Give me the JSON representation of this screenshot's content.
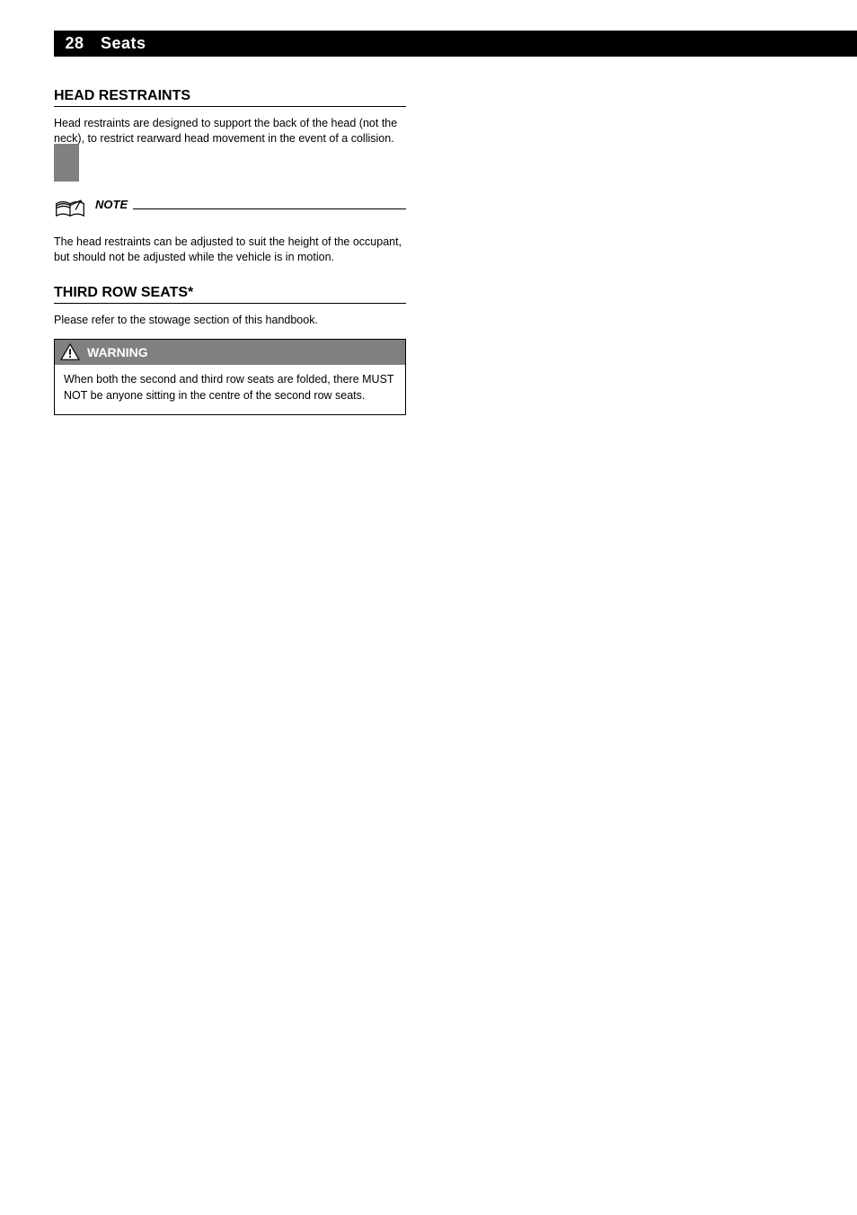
{
  "page_number": "28",
  "header_title": "Seats",
  "section1": {
    "title": "HEAD RESTRAINTS",
    "para": "Head restraints are designed to support the back of the head (not the neck), to restrict rearward head movement in the event of a collision."
  },
  "note": {
    "label": "NOTE",
    "body": "The head restraints can be adjusted to suit the height of the occupant, but should not be adjusted while the vehicle is in motion."
  },
  "section2": {
    "title": "THIRD ROW SEATS*",
    "para": "Please refer to the stowage section of this handbook.",
    "warning_label": "WARNING",
    "warning_body": "When both the second and third row seats are folded, there MUST NOT be anyone sitting in the centre of the second row seats."
  }
}
